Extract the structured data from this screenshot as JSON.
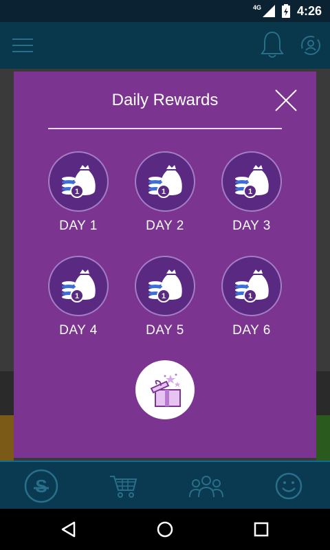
{
  "status_bar": {
    "time": "4:26",
    "network": "4G"
  },
  "dialog": {
    "title": "Daily Rewards",
    "days": [
      {
        "label": "DAY 1",
        "coin_value": "1"
      },
      {
        "label": "DAY 2",
        "coin_value": "1"
      },
      {
        "label": "DAY 3",
        "coin_value": "1"
      },
      {
        "label": "DAY 4",
        "coin_value": "1"
      },
      {
        "label": "DAY 5",
        "coin_value": "1"
      },
      {
        "label": "DAY 6",
        "coin_value": "1"
      }
    ]
  },
  "icons": {
    "app_bar": [
      "menu-icon",
      "bell-icon",
      "sync-profile-icon"
    ],
    "tabs": [
      "s-coin-icon",
      "cart-icon",
      "people-icon",
      "smiley-icon"
    ],
    "nav": [
      "back-icon",
      "home-icon",
      "recents-icon"
    ]
  },
  "colors": {
    "dialog": "#7b3591",
    "circle": "#5a2a82",
    "app_bar": "#09384d"
  }
}
